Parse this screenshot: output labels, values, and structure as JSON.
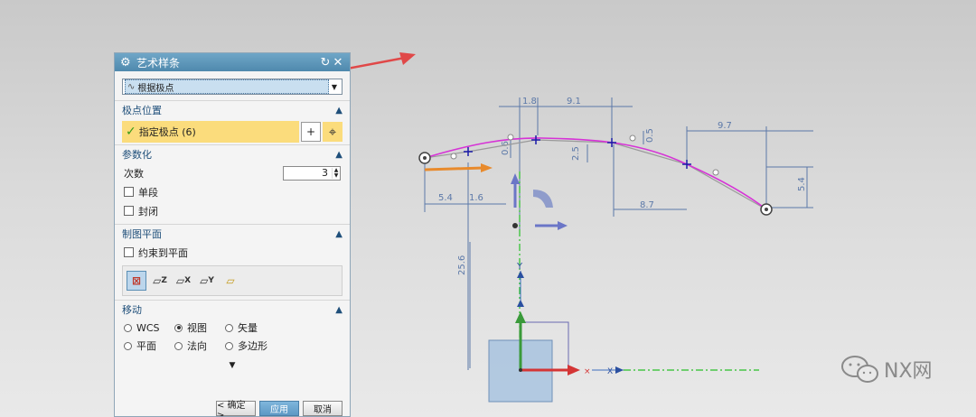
{
  "dialog": {
    "title": "艺术样条",
    "type_select": "根据极点",
    "pole_section": {
      "title": "极点位置",
      "specify_label": "指定极点 (6)"
    },
    "param_section": {
      "title": "参数化",
      "degree_label": "次数",
      "degree_value": "3",
      "single_segment": "单段",
      "closed": "封闭"
    },
    "plane_section": {
      "title": "制图平面",
      "constrain_label": "约束到平面",
      "plane_buttons": [
        "auto-plane",
        "zc-plane",
        "xc-plane",
        "yc-plane",
        "custom-plane"
      ]
    },
    "move_section": {
      "title": "移动",
      "options": [
        "WCS",
        "视图",
        "矢量",
        "平面",
        "法向",
        "多边形"
      ],
      "selected": "视图"
    },
    "buttons": {
      "ok": "< 确定 >",
      "apply": "应用",
      "cancel": "取消"
    }
  },
  "dimensions": {
    "d_1_8": "1.8",
    "d_9_1": "9.1",
    "d_9_7": "9.7",
    "d_5_4_left": "5.4",
    "d_1_6": "1.6",
    "d_8_7": "8.7",
    "d_5_4_right": "5.4",
    "d_25_6": "25.6",
    "v_0_6": "0.6",
    "v_2_5": "2.5",
    "v_0_5": "0.5"
  },
  "axes": {
    "y": "Y",
    "x": "X"
  },
  "watermark": "NX网",
  "colors": {
    "spline": "#d633d6",
    "dim": "#5b78a8",
    "axis_x": "#d43535",
    "axis_y": "#3a9a3a",
    "accent_arrow": "#e04848"
  }
}
